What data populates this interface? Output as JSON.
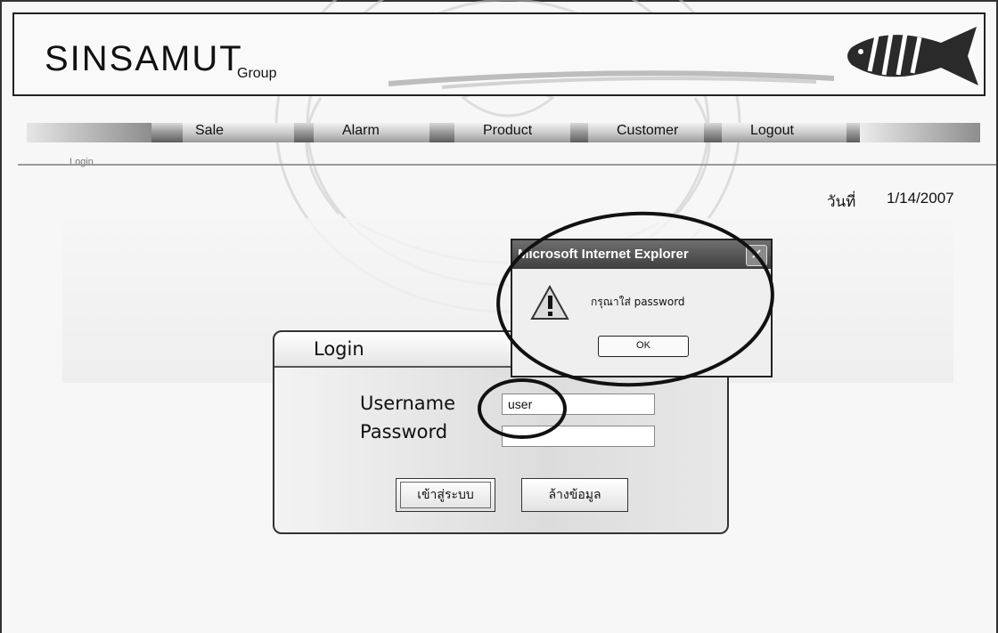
{
  "header": {
    "logo_main": "SINSAMUT",
    "logo_sub": "Group"
  },
  "nav": [
    {
      "label": "Sale"
    },
    {
      "label": "Alarm"
    },
    {
      "label": "Product"
    },
    {
      "label": "Customer"
    },
    {
      "label": "Logout"
    }
  ],
  "breadcrumb": "Login",
  "date": {
    "label": "วันที่",
    "value": "1/14/2007"
  },
  "login": {
    "title": "Login",
    "username_label": "Username",
    "password_label": "Password",
    "username_value": "user",
    "password_value": "",
    "submit_label": "เข้าสู่ระบบ",
    "clear_label": "ล้างข้อมูล"
  },
  "dialog": {
    "title": "Microsoft Internet Explorer",
    "close_glyph": "✕",
    "message": "กรุณาใส่ password",
    "ok_label": "OK",
    "icon": "warning-icon"
  },
  "colors": {
    "annotation": "#111111",
    "nav_dark": "#5d5d5d"
  }
}
